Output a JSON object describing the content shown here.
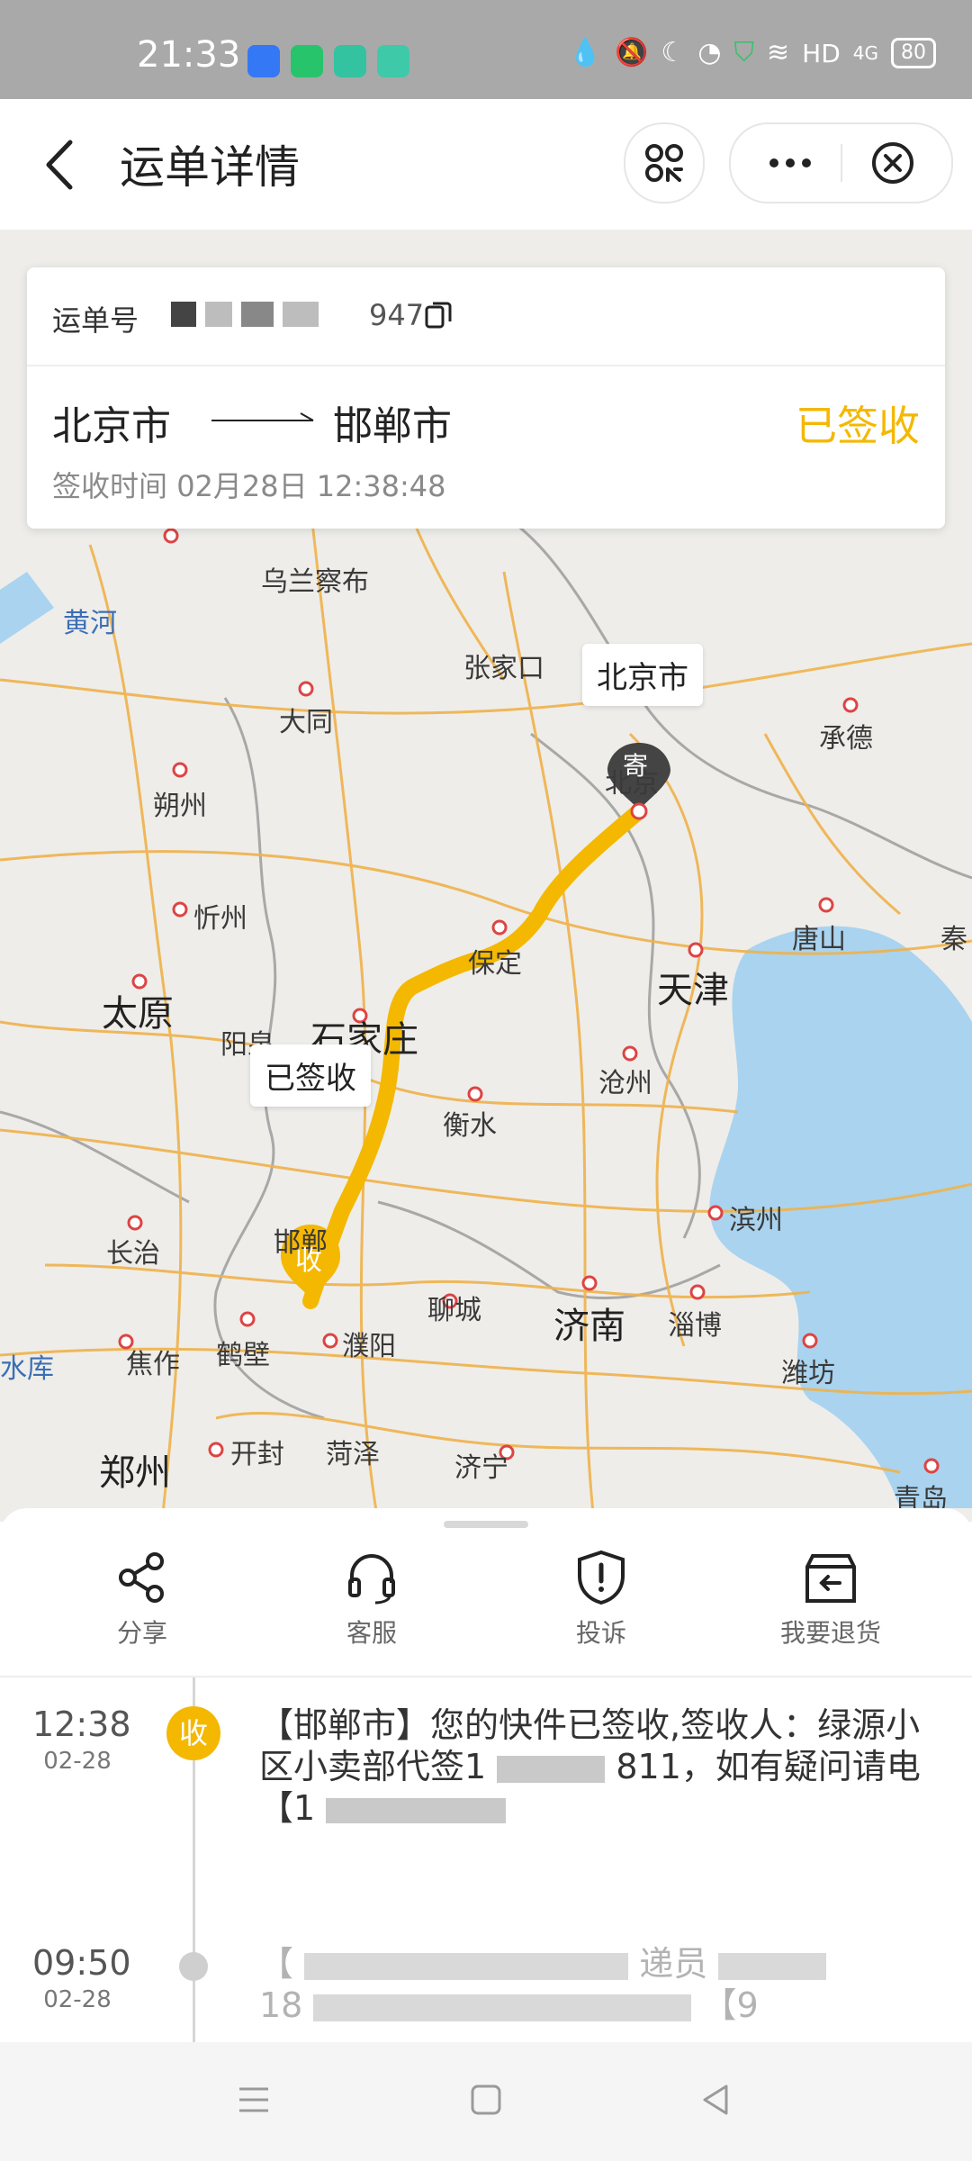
{
  "status_bar": {
    "time": "21:33",
    "network": "HD",
    "signal": "4G",
    "battery": "80"
  },
  "header": {
    "title": "运单详情",
    "icons": [
      "back-icon",
      "scan-icon",
      "more-icon",
      "close-icon"
    ]
  },
  "waybill": {
    "number_label": "运单号",
    "number_visible_suffix": "947",
    "from": "北京市",
    "to": "邯郸市",
    "status": "已签收",
    "sign_time_label": "签收时间",
    "sign_time": "02月28日 12:38:48",
    "status_color": "#f5b800"
  },
  "map": {
    "labels": {
      "wulanchabu": "乌兰察布",
      "huanghe": "黄河",
      "zhangjiakou": "张家口",
      "datong": "大同",
      "chengde": "承德",
      "shuozhou": "朔州",
      "beijing_map": "北京",
      "xinzhou": "忻州",
      "tangshan": "唐山",
      "qin": "秦",
      "baoding": "保定",
      "tianjin": "天津",
      "taiyuan": "太原",
      "yangquan": "阳泉",
      "shijiazhuang": "石家庄",
      "cangzhou": "沧州",
      "hengshui": "衡水",
      "binzhou": "滨州",
      "changzhi": "长治",
      "handan": "邯郸",
      "liaocheng": "聊城",
      "jinan": "济南",
      "zibo": "淄博",
      "reservoir": "水库",
      "jiaozuo": "焦作",
      "hebi": "鹤壁",
      "puyang": "濮阳",
      "weifang": "潍坊",
      "zhengzhou": "郑州",
      "kaifeng": "开封",
      "heze": "菏泽",
      "jining": "济宁",
      "qingdao": "青岛"
    },
    "origin_callout": "北京市",
    "origin_marker": "寄",
    "dest_callout": "已签收",
    "dest_marker": "收",
    "route_color": "#f5b800"
  },
  "actions": [
    {
      "label": "分享",
      "icon": "share-icon"
    },
    {
      "label": "客服",
      "icon": "headset-icon"
    },
    {
      "label": "投诉",
      "icon": "shield-alert-icon"
    },
    {
      "label": "我要退货",
      "icon": "return-box-icon"
    }
  ],
  "timeline": [
    {
      "time": "12:38",
      "date": "02-28",
      "node": "收",
      "text_visible": "【邯郸市】您的快件已签收,签收人：绿源小区小卖部代签1",
      "text_tail": "811，如有疑问请电",
      "text_line4": "【1"
    },
    {
      "time": "09:50",
      "date": "02-28",
      "text_visible": "【",
      "fragment_a": "递员",
      "fragment_b": "18",
      "fragment_c": "【9"
    }
  ]
}
